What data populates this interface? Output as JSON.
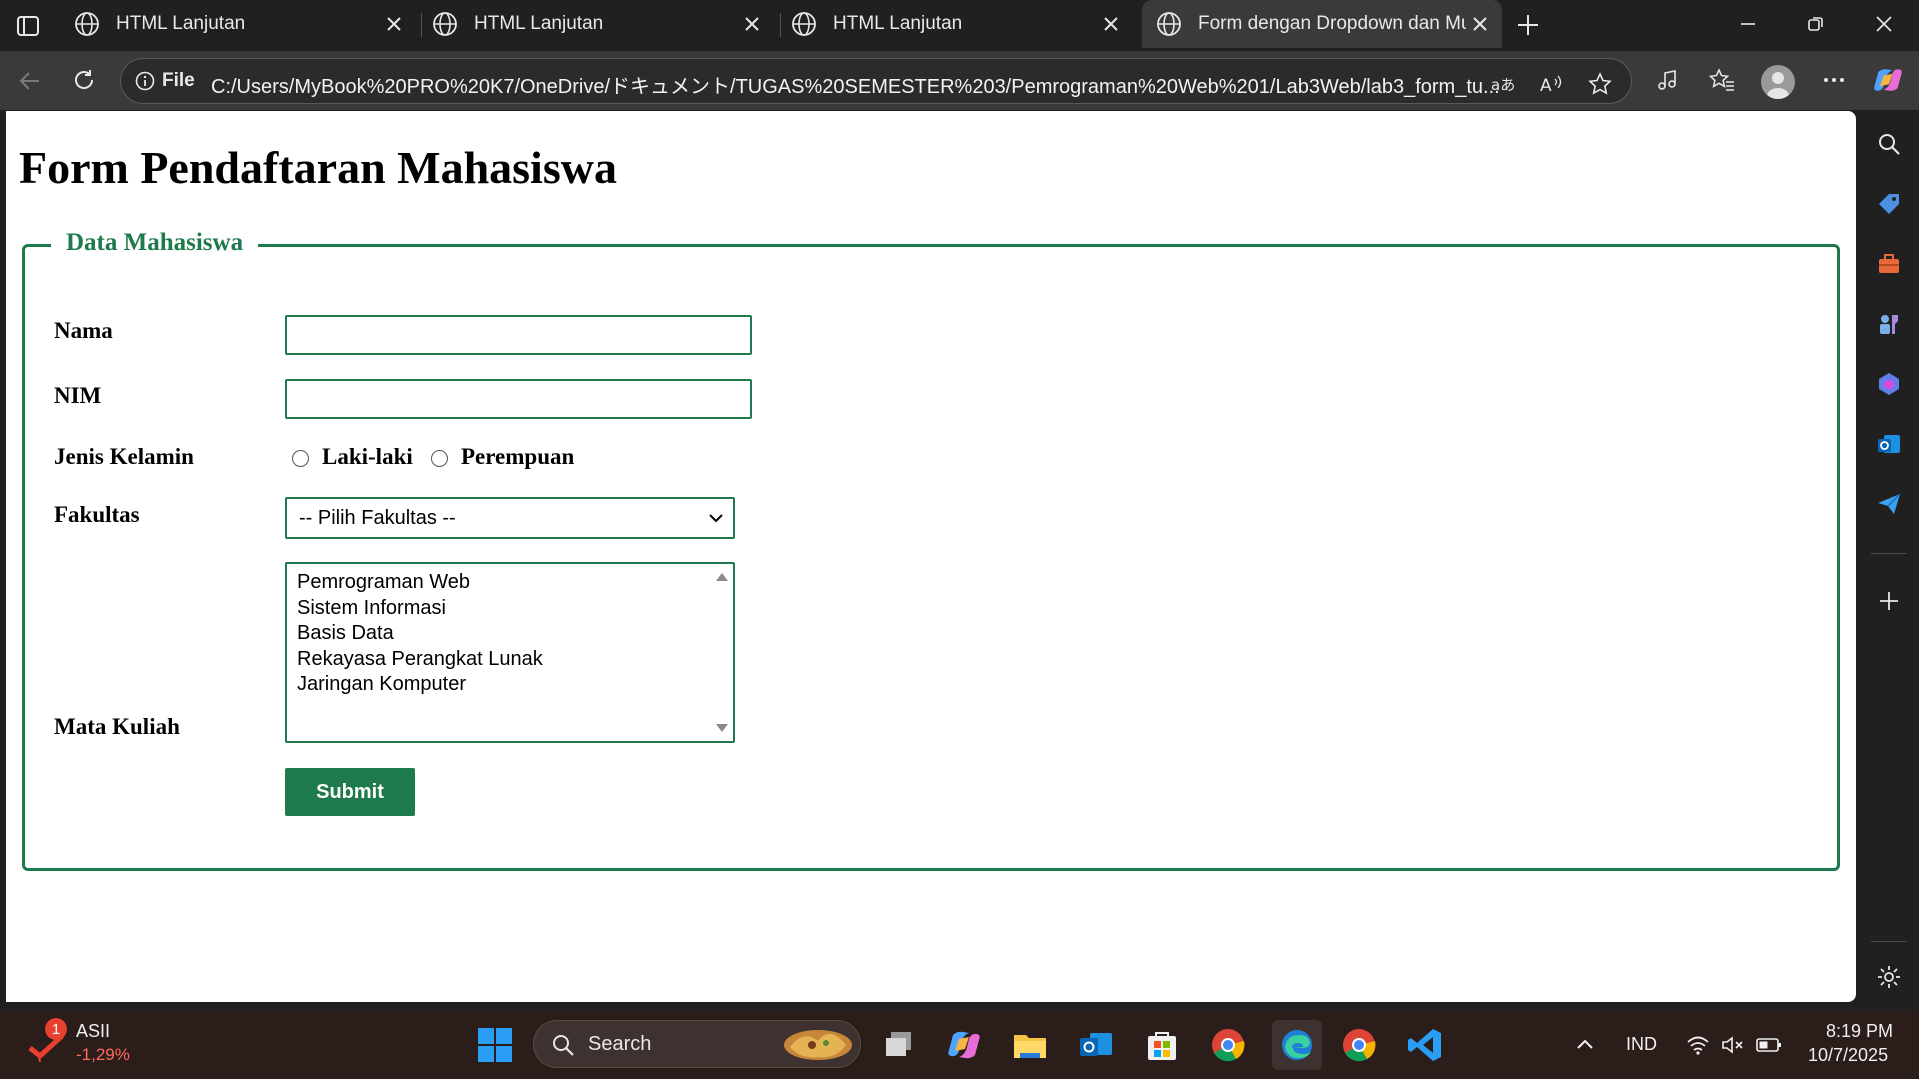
{
  "browser": {
    "tabs": [
      {
        "title": "HTML Lanjutan"
      },
      {
        "title": "HTML Lanjutan"
      },
      {
        "title": "HTML Lanjutan"
      },
      {
        "title": "Form dengan Dropdown dan Mul"
      }
    ],
    "address": {
      "scheme_label": "File",
      "url": "C:/Users/MyBook%20PRO%20K7/OneDrive/ドキュメント/TUGAS%20SEMESTER%203/Pemrograman%20Web%201/Lab3Web/lab3_form_tu..."
    }
  },
  "page": {
    "title": "Form Pendaftaran Mahasiswa",
    "legend": "Data Mahasiswa",
    "fields": {
      "nama_label": "Nama",
      "nim_label": "NIM",
      "gender_label": "Jenis Kelamin",
      "gender_options": [
        "Laki-laki",
        "Perempuan"
      ],
      "fakultas_label": "Fakultas",
      "fakultas_selected": "-- Pilih Fakultas --",
      "matkul_label": "Mata Kuliah",
      "matkul_options": [
        "Pemrograman Web",
        "Sistem Informasi",
        "Basis Data",
        "Rekayasa Perangkat Lunak",
        "Jaringan Komputer"
      ]
    },
    "submit_label": "Submit",
    "accent_color": "#1e7a4c"
  },
  "taskbar": {
    "stock_name": "ASII",
    "stock_change": "-1,29%",
    "stock_badge": "1",
    "search_placeholder": "Search",
    "language": "IND",
    "time": "8:19 PM",
    "date": "10/7/2025"
  }
}
